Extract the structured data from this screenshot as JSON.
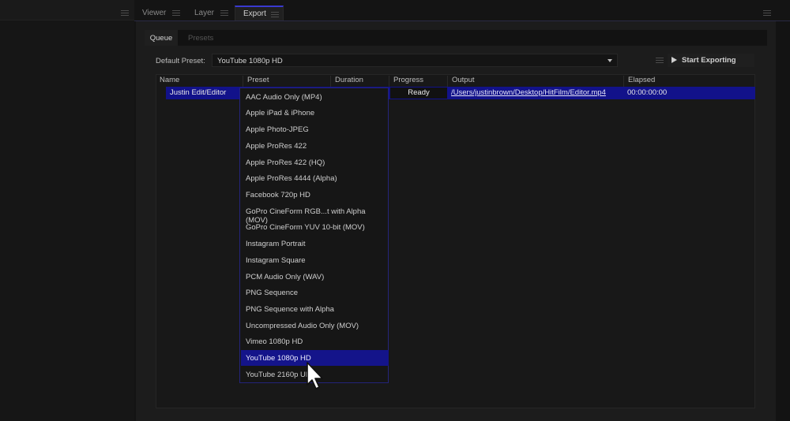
{
  "tabs": [
    {
      "label": "Viewer"
    },
    {
      "label": "Layer"
    },
    {
      "label": "Export"
    }
  ],
  "subtabs": [
    {
      "label": "Queue"
    },
    {
      "label": "Presets"
    }
  ],
  "default_preset": {
    "label": "Default Preset:",
    "value": "YouTube 1080p HD"
  },
  "start_button": {
    "label": "Start Exporting"
  },
  "table": {
    "columns": [
      "Name",
      "Preset",
      "Duration",
      "Progress",
      "Output",
      "Elapsed"
    ],
    "row": {
      "name": "Justin Edit/Editor",
      "progress": "Ready",
      "output": "/Users/justinbrown/Desktop/HitFilm/Editor.mp4",
      "elapsed": "00:00:00:00"
    }
  },
  "preset_options": [
    "AAC Audio Only (MP4)",
    "Apple iPad & iPhone",
    "Apple Photo-JPEG",
    "Apple ProRes 422",
    "Apple ProRes 422 (HQ)",
    "Apple ProRes 4444 (Alpha)",
    "Facebook 720p HD",
    "GoPro CineForm RGB...t with Alpha (MOV)",
    "GoPro CineForm YUV 10-bit (MOV)",
    "Instagram Portrait",
    "Instagram Square",
    "PCM Audio Only (WAV)",
    "PNG Sequence",
    "PNG Sequence with Alpha",
    "Uncompressed Audio Only (MOV)",
    "Vimeo 1080p HD",
    "YouTube 1080p HD",
    "YouTube 2160p UHD"
  ],
  "selected_option": "YouTube 1080p HD",
  "colors": {
    "accent": "#14148a",
    "background": "#131313"
  }
}
